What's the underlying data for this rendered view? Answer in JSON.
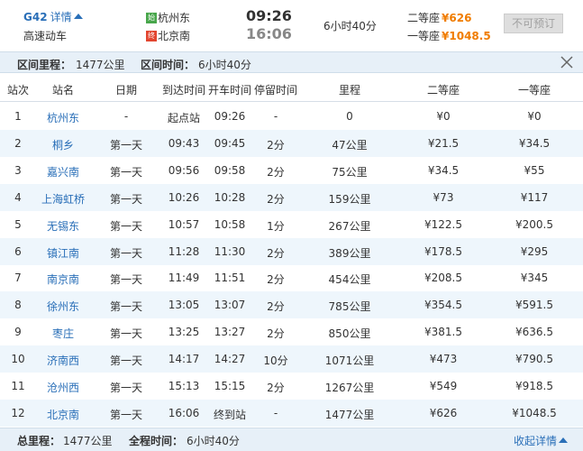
{
  "summary": {
    "train_no": "G42",
    "detail_label": "详情",
    "train_type": "高速动车",
    "from_badge": "始",
    "from_station": "杭州东",
    "to_badge": "终",
    "to_station": "北京南",
    "departure": "09:26",
    "arrival": "16:06",
    "duration": "6小时40分",
    "second_class_label": "二等座",
    "second_class_price": "¥626",
    "first_class_label": "一等座",
    "first_class_price": "¥1048.5",
    "book_button": "不可预订"
  },
  "info_bar": {
    "distance_label": "区间里程：",
    "distance": "1477公里",
    "time_label": "区间时间：",
    "time": "6小时40分"
  },
  "table": {
    "headers": [
      "站次",
      "站名",
      "日期",
      "到达时间",
      "开车时间",
      "停留时间",
      "里程",
      "二等座",
      "一等座"
    ],
    "rows": [
      [
        "1",
        "杭州东",
        "-",
        "起点站",
        "09:26",
        "-",
        "0",
        "¥0",
        "¥0"
      ],
      [
        "2",
        "桐乡",
        "第一天",
        "09:43",
        "09:45",
        "2分",
        "47公里",
        "¥21.5",
        "¥34.5"
      ],
      [
        "3",
        "嘉兴南",
        "第一天",
        "09:56",
        "09:58",
        "2分",
        "75公里",
        "¥34.5",
        "¥55"
      ],
      [
        "4",
        "上海虹桥",
        "第一天",
        "10:26",
        "10:28",
        "2分",
        "159公里",
        "¥73",
        "¥117"
      ],
      [
        "5",
        "无锡东",
        "第一天",
        "10:57",
        "10:58",
        "1分",
        "267公里",
        "¥122.5",
        "¥200.5"
      ],
      [
        "6",
        "镇江南",
        "第一天",
        "11:28",
        "11:30",
        "2分",
        "389公里",
        "¥178.5",
        "¥295"
      ],
      [
        "7",
        "南京南",
        "第一天",
        "11:49",
        "11:51",
        "2分",
        "454公里",
        "¥208.5",
        "¥345"
      ],
      [
        "8",
        "徐州东",
        "第一天",
        "13:05",
        "13:07",
        "2分",
        "785公里",
        "¥354.5",
        "¥591.5"
      ],
      [
        "9",
        "枣庄",
        "第一天",
        "13:25",
        "13:27",
        "2分",
        "850公里",
        "¥381.5",
        "¥636.5"
      ],
      [
        "10",
        "济南西",
        "第一天",
        "14:17",
        "14:27",
        "10分",
        "1071公里",
        "¥473",
        "¥790.5"
      ],
      [
        "11",
        "沧州西",
        "第一天",
        "15:13",
        "15:15",
        "2分",
        "1267公里",
        "¥549",
        "¥918.5"
      ],
      [
        "12",
        "北京南",
        "第一天",
        "16:06",
        "终到站",
        "-",
        "1477公里",
        "¥626",
        "¥1048.5"
      ]
    ]
  },
  "footer": {
    "total_distance_label": "总里程：",
    "total_distance": "1477公里",
    "total_time_label": "全程时间：",
    "total_time": "6小时40分",
    "collapse_label": "收起详情"
  },
  "colors": {
    "link_blue": "#2a6fb8",
    "price_orange": "#f07c00",
    "row_alt": "#eef6fc",
    "bar_bg": "#e7f0f8",
    "start_badge": "#48a64b",
    "end_badge": "#e2452f"
  },
  "icons": {
    "detail_toggle": "chevron-up-icon",
    "close": "close-icon",
    "collapse_toggle": "chevron-up-icon"
  }
}
